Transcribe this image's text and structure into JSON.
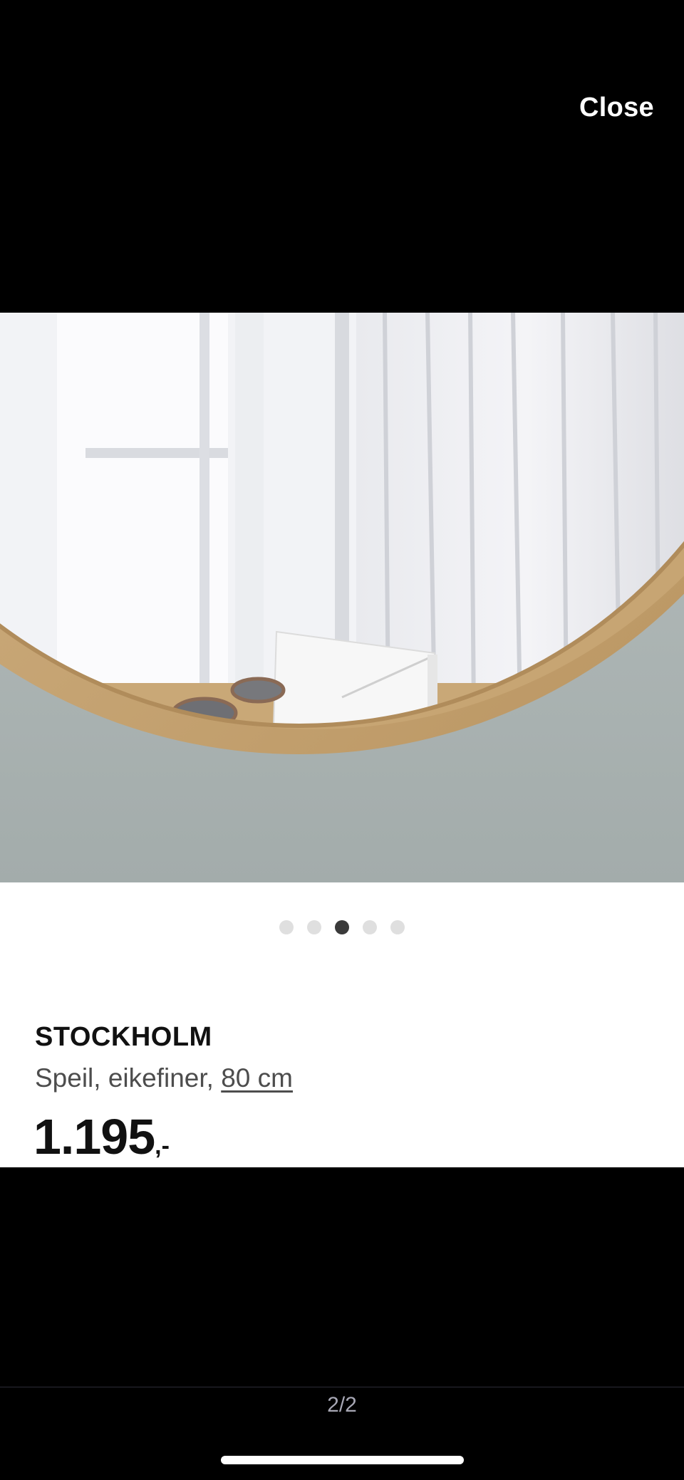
{
  "header": {
    "close_label": "Close"
  },
  "gallery": {
    "image_alt": "Round mirror with oak veneer frame and shelf, holding sunglasses, a watch and an envelope",
    "dot_count": 5,
    "active_index": 2
  },
  "product": {
    "name": "STOCKHOLM",
    "description": "Speil, eikefiner, ",
    "size_link": "80 cm",
    "price": "1.195",
    "price_suffix": ",-"
  },
  "pager": {
    "text": "2/2"
  }
}
